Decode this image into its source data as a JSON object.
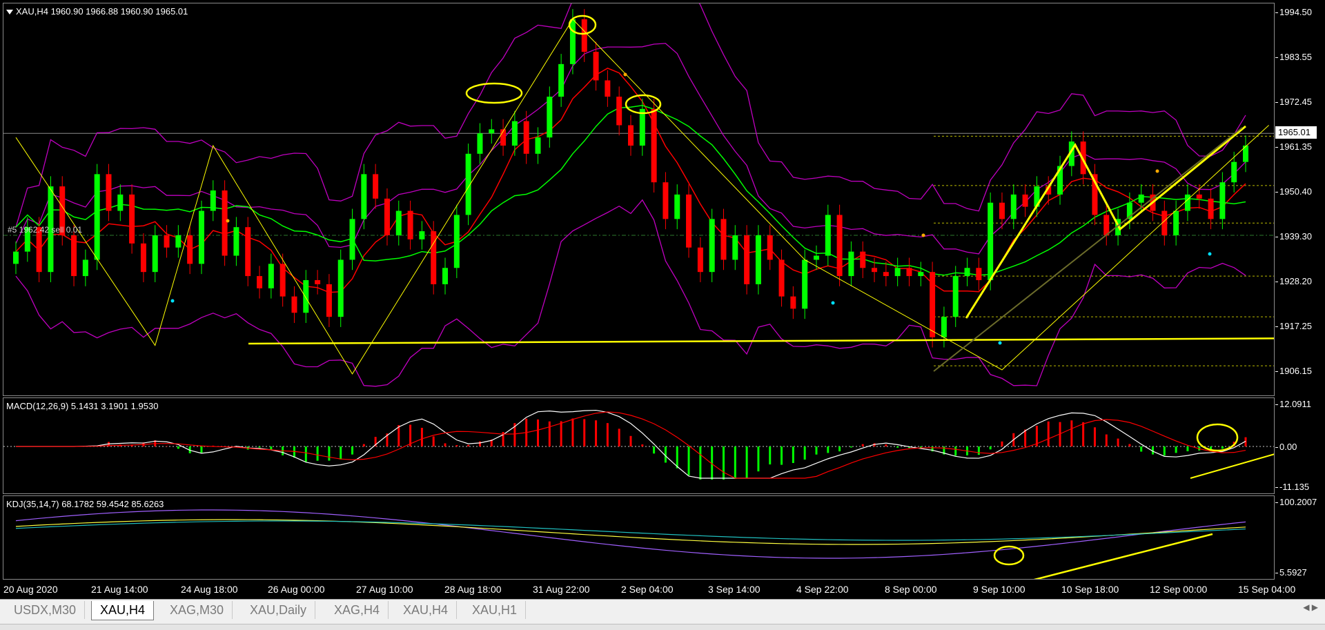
{
  "chart": {
    "symbol_label": "XAU,H4  1960.90 1966.88 1960.90 1965.01",
    "trade_label": "#5 1962.42 sell 0.01",
    "current_price": "1965.01",
    "price_ticks": [
      "1994.50",
      "1983.55",
      "1972.45",
      "1961.35",
      "1950.40",
      "1939.30",
      "1928.20",
      "1917.25",
      "1906.15"
    ],
    "date_ticks": [
      "20 Aug 2020",
      "21 Aug 14:00",
      "24 Aug 18:00",
      "26 Aug 00:00",
      "27 Aug 10:00",
      "28 Aug 18:00",
      "31 Aug 22:00",
      "2 Sep 04:00",
      "3 Sep 14:00",
      "4 Sep 22:00",
      "8 Sep 00:00",
      "9 Sep 10:00",
      "10 Sep 18:00",
      "12 Sep 00:00",
      "15 Sep 04:00"
    ],
    "candles": [
      1936,
      1942,
      1931,
      1952,
      1940,
      1930,
      1934,
      1955,
      1946,
      1950,
      1938,
      1931,
      1940,
      1937,
      1940,
      1933,
      1946,
      1951,
      1935,
      1942,
      1930,
      1927,
      1933,
      1925,
      1921,
      1929,
      1928,
      1920,
      1934,
      1944,
      1955,
      1949,
      1940,
      1946,
      1939,
      1941,
      1928,
      1932,
      1945,
      1960,
      1965,
      1966,
      1962,
      1968,
      1960,
      1964,
      1974,
      1982,
      1993,
      1985,
      1978,
      1974,
      1967,
      1962,
      1971,
      1953,
      1944,
      1950,
      1937,
      1931,
      1944,
      1934,
      1940,
      1928,
      1940,
      1934,
      1925,
      1922,
      1934,
      1935,
      1945,
      1930,
      1936,
      1932,
      1931,
      1930,
      1932,
      1930,
      1931,
      1915,
      1920,
      1930,
      1932,
      1929,
      1948,
      1944,
      1950,
      1947,
      1952,
      1950,
      1957,
      1963,
      1955,
      1945,
      1940,
      1944,
      1948,
      1950,
      1946,
      1940,
      1946,
      1950,
      1949,
      1944,
      1953,
      1958,
      1962
    ]
  },
  "indicators": {
    "macd_label": "MACD(12,26,9) 5.1431 3.1901 1.9530",
    "macd_ticks": [
      "12.0911",
      "0.00",
      "-11.135"
    ],
    "kdj_label": "KDJ(35,14,7) 68.1782 59.4542 85.6263",
    "kdj_ticks": [
      "100.2007",
      "5.5927"
    ]
  },
  "colors": {
    "bull": "#00ff00",
    "bear": "#ff0000",
    "bands": "#c000c0",
    "annotation": "#ffff00"
  },
  "tabs": [
    {
      "label": "USDX,M30",
      "active": false
    },
    {
      "label": "XAU,H4",
      "active": true
    },
    {
      "label": "XAG,M30",
      "active": false
    },
    {
      "label": "XAU,Daily",
      "active": false
    },
    {
      "label": "XAG,H4",
      "active": false
    },
    {
      "label": "XAU,H4",
      "active": false
    },
    {
      "label": "XAU,H1",
      "active": false
    }
  ],
  "tab_scroll": "◀ ▶"
}
